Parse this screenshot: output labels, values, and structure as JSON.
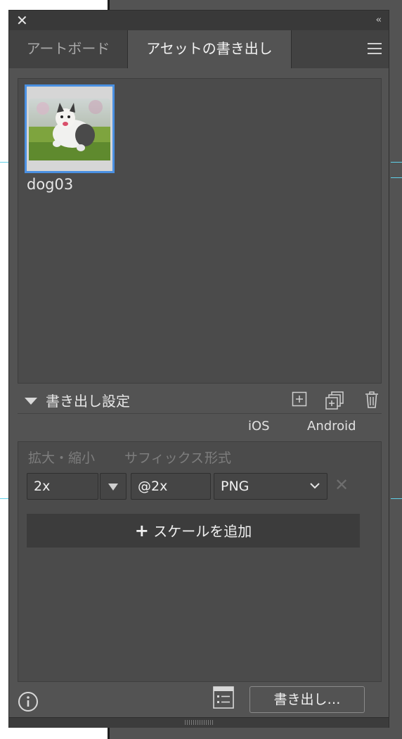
{
  "panel": {
    "tabs": [
      {
        "label": "アートボード",
        "active": false
      },
      {
        "label": "アセットの書き出し",
        "active": true
      }
    ]
  },
  "assets": [
    {
      "name": "dog03",
      "selected": true
    }
  ],
  "export_settings": {
    "title": "書き出し設定",
    "platforms": {
      "ios": "iOS",
      "android": "Android"
    },
    "columns": {
      "scale": "拡大・縮小",
      "suffix": "サフィックス",
      "format": "形式"
    },
    "rows": [
      {
        "scale": "2x",
        "suffix": "@2x",
        "format": "PNG"
      }
    ],
    "add_scale_label": "スケールを追加"
  },
  "footer": {
    "export_button": "書き出し…"
  },
  "colors": {
    "panel_bg": "#535353",
    "accent_selection": "#4a90e2",
    "guide": "#5fd0e8"
  }
}
